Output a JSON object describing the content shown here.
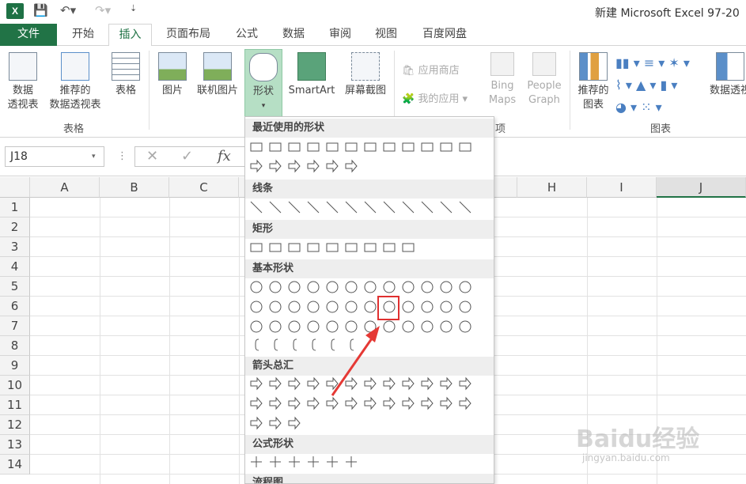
{
  "titlebar": {
    "app_logo": "X",
    "title": "新建 Microsoft Excel 97-20"
  },
  "tabs": {
    "file": "文件",
    "home": "开始",
    "insert": "插入",
    "page_layout": "页面布局",
    "formulas": "公式",
    "data": "数据",
    "review": "审阅",
    "view": "视图",
    "baidu_disk": "百度网盘"
  },
  "ribbon": {
    "pivot_table": "数据\n透视表",
    "recommended_pivot": "推荐的\n数据透视表",
    "table": "表格",
    "group_tables": "表格",
    "picture": "图片",
    "online_picture": "联机图片",
    "shapes": "形状",
    "smartart": "SmartArt",
    "screenshot": "屏幕截图",
    "app_store": "应用商店",
    "my_apps": "我的应用",
    "bing_maps": "Bing\nMaps",
    "people_graph": "People\nGraph",
    "group_apps_fragment": "项",
    "recommended_charts": "推荐的\n图表",
    "group_charts": "图表",
    "pivot_chart": "数据透视"
  },
  "formula_bar": {
    "name_box": "J18",
    "fx": "fx"
  },
  "columns": [
    "A",
    "B",
    "C",
    "H",
    "I",
    "J"
  ],
  "rows": [
    "1",
    "2",
    "3",
    "4",
    "5",
    "6",
    "7",
    "8",
    "9",
    "10",
    "11",
    "12",
    "13",
    "14"
  ],
  "shapes_menu": {
    "recent": "最近使用的形状",
    "lines": "线条",
    "rectangles": "矩形",
    "basic": "基本形状",
    "arrows": "箭头总汇",
    "equation": "公式形状",
    "flowchart": "流程图"
  },
  "watermark": {
    "brand": "Baidu经验",
    "url": "jingyan.baidu.com"
  }
}
